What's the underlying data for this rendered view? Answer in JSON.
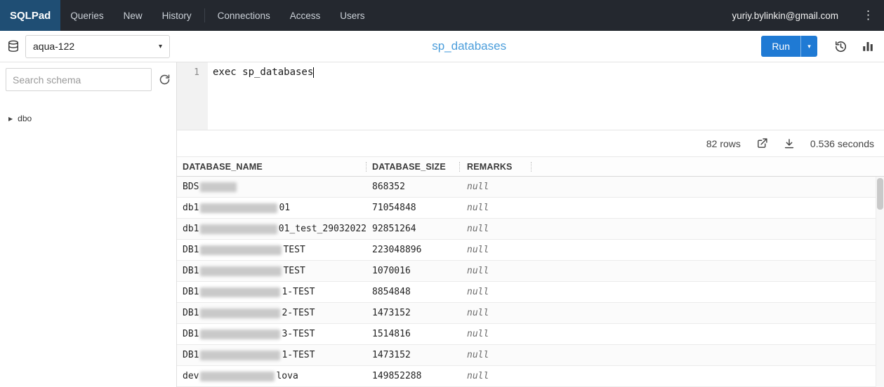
{
  "colors": {
    "navbar_bg": "#24282f",
    "brand_bg": "#1f4e74",
    "accent_blue": "#1f7ad4",
    "title_blue": "#4a9ddb",
    "null_gray": "#6b6b6b"
  },
  "icons": {
    "kebab": "⋮",
    "caret_down": "▾",
    "tree_expander": "▶"
  },
  "navbar": {
    "brand": "SQLPad",
    "links_left": [
      "Queries",
      "New",
      "History"
    ],
    "links_right": [
      "Connections",
      "Access",
      "Users"
    ],
    "user_email": "yuriy.bylinkin@gmail.com"
  },
  "toolbar": {
    "connection_value": "aqua-122",
    "query_title": "sp_databases",
    "run_label": "Run"
  },
  "sidebar": {
    "search_placeholder": "Search schema",
    "tree_items": [
      {
        "label": "dbo"
      }
    ]
  },
  "editor": {
    "line_number": "1",
    "code": "exec sp_databases"
  },
  "results": {
    "row_count_label": "82 rows",
    "elapsed_label": "0.536 seconds",
    "columns": [
      "DATABASE_NAME",
      "DATABASE_SIZE",
      "REMARKS"
    ],
    "rows": [
      {
        "name_prefix": "BDS",
        "redacted_width": 52,
        "name_suffix": "",
        "size": "868352",
        "remarks": "null"
      },
      {
        "name_prefix": "db1",
        "redacted_width": 110,
        "name_suffix": "01",
        "size": "71054848",
        "remarks": "null"
      },
      {
        "name_prefix": "db1",
        "redacted_width": 110,
        "name_suffix": "01_test_29032022",
        "size": "92851264",
        "remarks": "null"
      },
      {
        "name_prefix": "DB1",
        "redacted_width": 116,
        "name_suffix": "TEST",
        "size": "223048896",
        "remarks": "null"
      },
      {
        "name_prefix": "DB1",
        "redacted_width": 116,
        "name_suffix": "TEST",
        "size": "1070016",
        "remarks": "null"
      },
      {
        "name_prefix": "DB1",
        "redacted_width": 114,
        "name_suffix": "1-TEST",
        "size": "8854848",
        "remarks": "null"
      },
      {
        "name_prefix": "DB1",
        "redacted_width": 114,
        "name_suffix": "2-TEST",
        "size": "1473152",
        "remarks": "null"
      },
      {
        "name_prefix": "DB1",
        "redacted_width": 114,
        "name_suffix": "3-TEST",
        "size": "1514816",
        "remarks": "null"
      },
      {
        "name_prefix": "DB1",
        "redacted_width": 114,
        "name_suffix": "1-TEST",
        "size": "1473152",
        "remarks": "null"
      },
      {
        "name_prefix": "dev",
        "redacted_width": 106,
        "name_suffix": "lova",
        "size": "149852288",
        "remarks": "null"
      }
    ]
  }
}
